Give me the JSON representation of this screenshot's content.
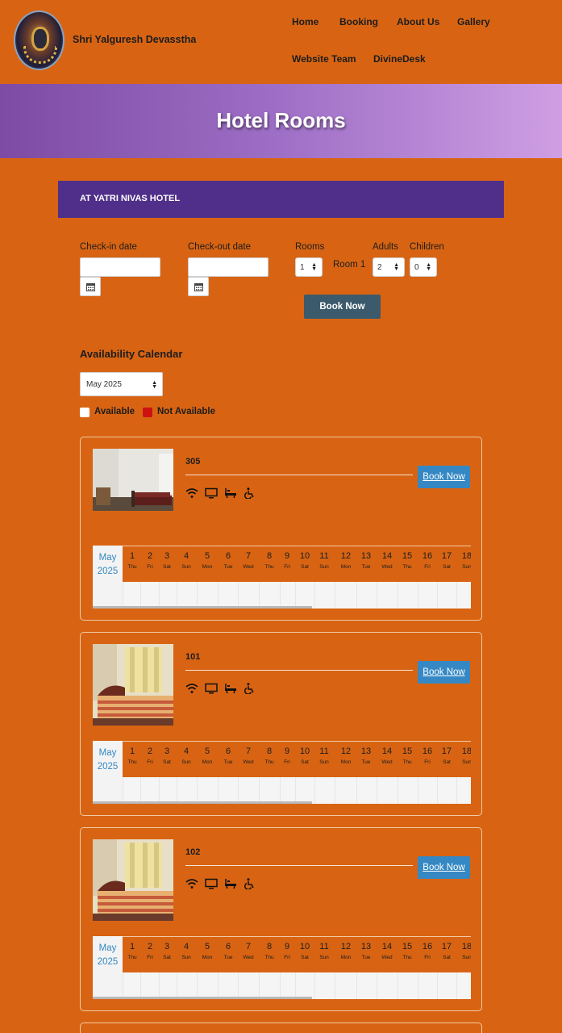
{
  "header": {
    "site_name": "Shri Yalguresh Devasstha",
    "nav": [
      "Home",
      "Booking",
      "About Us",
      "Gallery",
      "Website Team",
      "DivineDesk"
    ]
  },
  "banner": {
    "title": "Hotel Rooms"
  },
  "hotel": {
    "name": "AT YATRI NIVAS HOTEL"
  },
  "form": {
    "checkin_label": "Check-in date",
    "checkout_label": "Check-out date",
    "rooms_label": "Rooms",
    "rooms_value": "1",
    "room_name": "Room 1",
    "adults_label": "Adults",
    "adults_value": "2",
    "children_label": "Children",
    "children_value": "0",
    "book_label": "Book Now"
  },
  "availability": {
    "title": "Availability Calendar",
    "month_select": "May 2025",
    "legend_available": "Available",
    "legend_not_available": "Not Available",
    "legend_not_available_color": "#cc1111"
  },
  "calendar": {
    "month": "May",
    "year": "2025",
    "days": [
      {
        "n": "1",
        "w": "Thu"
      },
      {
        "n": "2",
        "w": "Fri"
      },
      {
        "n": "3",
        "w": "Sat"
      },
      {
        "n": "4",
        "w": "Sun"
      },
      {
        "n": "5",
        "w": "Mon"
      },
      {
        "n": "6",
        "w": "Tue"
      },
      {
        "n": "7",
        "w": "Wed"
      },
      {
        "n": "8",
        "w": "Thu"
      },
      {
        "n": "9",
        "w": "Fri"
      },
      {
        "n": "10",
        "w": "Sat"
      },
      {
        "n": "11",
        "w": "Sun"
      },
      {
        "n": "12",
        "w": "Mon"
      },
      {
        "n": "13",
        "w": "Tue"
      },
      {
        "n": "14",
        "w": "Wed"
      },
      {
        "n": "15",
        "w": "Thu"
      },
      {
        "n": "16",
        "w": "Fri"
      },
      {
        "n": "17",
        "w": "Sat"
      },
      {
        "n": "18",
        "w": "Sun"
      }
    ]
  },
  "rooms": [
    {
      "number": "305",
      "book_label": "Book Now",
      "amenities": [
        "wifi-icon",
        "tv-icon",
        "bathtub-icon",
        "wheelchair-icon"
      ]
    },
    {
      "number": "101",
      "book_label": "Book Now",
      "amenities": [
        "wifi-icon",
        "tv-icon",
        "bathtub-icon",
        "wheelchair-icon"
      ]
    },
    {
      "number": "102",
      "book_label": "Book Now",
      "amenities": [
        "wifi-icon",
        "tv-icon",
        "bathtub-icon",
        "wheelchair-icon"
      ]
    }
  ]
}
